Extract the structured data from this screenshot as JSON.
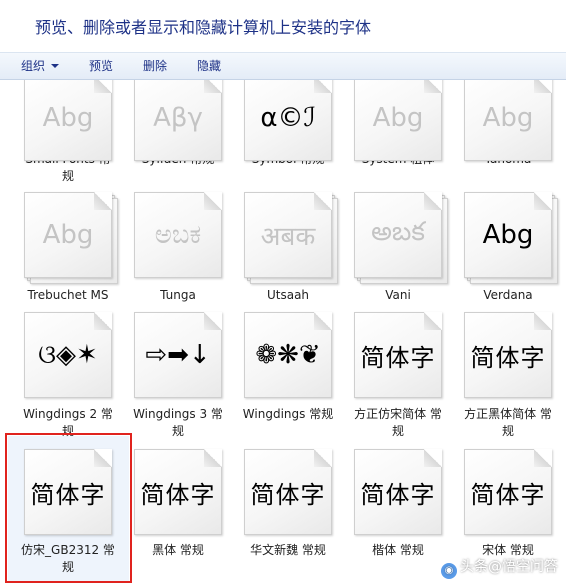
{
  "header": {
    "title": "预览、删除或者显示和隐藏计算机上安装的字体"
  },
  "toolbar": {
    "organize": "组织",
    "preview": "预览",
    "delete": "删除",
    "hide": "隐藏"
  },
  "fonts": [
    {
      "name": "Small Fonts 常\n规",
      "sample": "Abg",
      "faded": true,
      "stack": false
    },
    {
      "name": "Sylfaen 常规",
      "sample": "Αβγ",
      "faded": true,
      "stack": false
    },
    {
      "name": "Symbol 常规",
      "sample": "α©ℐ",
      "faded": false,
      "stack": false
    },
    {
      "name": "System 粗体",
      "sample": "Abg",
      "faded": true,
      "stack": false
    },
    {
      "name": "Tahoma",
      "sample": "Abg",
      "faded": true,
      "stack": false
    },
    {
      "name": "Trebuchet MS",
      "sample": "Abg",
      "faded": true,
      "stack": true
    },
    {
      "name": "Tunga",
      "sample": "ಅಬಕ",
      "faded": true,
      "stack": false
    },
    {
      "name": "Utsaah",
      "sample": "अबक",
      "faded": true,
      "stack": true
    },
    {
      "name": "Vani",
      "sample": "అబక",
      "faded": true,
      "stack": true
    },
    {
      "name": "Verdana",
      "sample": "Abg",
      "faded": false,
      "stack": true
    },
    {
      "name": "Wingdings 2 常\n规",
      "sample": "ଓ◈✶",
      "faded": false,
      "stack": false
    },
    {
      "name": "Wingdings 3 常\n规",
      "sample": "⇨➡↓",
      "faded": false,
      "stack": false
    },
    {
      "name": "Wingdings 常规",
      "sample": "❁❋❦",
      "faded": false,
      "stack": false
    },
    {
      "name": "方正仿宋简体 常\n规",
      "sample": "简体字",
      "faded": false,
      "stack": false
    },
    {
      "name": "方正黑体简体 常\n规",
      "sample": "简体字",
      "faded": false,
      "stack": false
    },
    {
      "name": "仿宋_GB2312 常\n规",
      "sample": "简体字",
      "faded": false,
      "stack": false
    },
    {
      "name": "黑体 常规",
      "sample": "简体字",
      "faded": false,
      "stack": false
    },
    {
      "name": "华文新魏 常规",
      "sample": "简体字",
      "faded": false,
      "stack": false
    },
    {
      "name": "楷体 常规",
      "sample": "简体字",
      "faded": false,
      "stack": false
    },
    {
      "name": "宋体 常规",
      "sample": "简体字",
      "faded": false,
      "stack": false
    }
  ],
  "selected_index": 15,
  "watermark": {
    "text": "头条@悟空问答",
    "icon": "chat-bubble-icon"
  }
}
